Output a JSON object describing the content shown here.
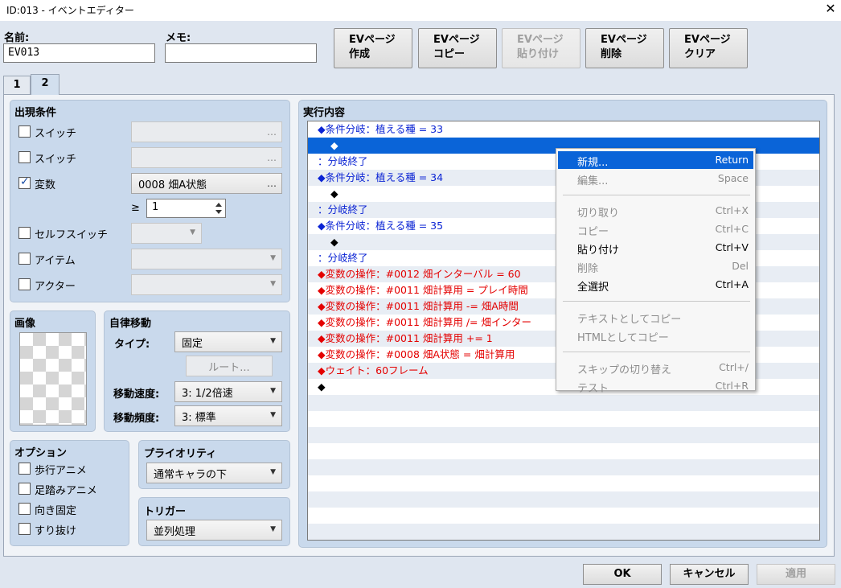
{
  "window": {
    "title": "ID:013 - イベントエディター",
    "close_glyph": "✕"
  },
  "header": {
    "name_label": "名前:",
    "name_value": "EV013",
    "memo_label": "メモ:",
    "memo_value": "",
    "buttons": [
      {
        "line1": "EVページ",
        "line2": "作成",
        "enabled": true
      },
      {
        "line1": "EVページ",
        "line2": "コピー",
        "enabled": true
      },
      {
        "line1": "EVページ",
        "line2": "貼り付け",
        "enabled": false
      },
      {
        "line1": "EVページ",
        "line2": "削除",
        "enabled": true
      },
      {
        "line1": "EVページ",
        "line2": "クリア",
        "enabled": true
      }
    ]
  },
  "tabs": [
    {
      "label": "1",
      "active": false
    },
    {
      "label": "2",
      "active": true
    }
  ],
  "conditions": {
    "title": "出現条件",
    "items": [
      {
        "label": "スイッチ",
        "checked": false,
        "value": "",
        "picker": "…"
      },
      {
        "label": "スイッチ",
        "checked": false,
        "value": "",
        "picker": "…"
      },
      {
        "label": "変数",
        "checked": true,
        "value": "0008 畑A状態",
        "picker": "…"
      },
      {
        "label": "セルフスイッチ",
        "checked": false,
        "value": "",
        "picker": "▼"
      },
      {
        "label": "アイテム",
        "checked": false,
        "value": "",
        "picker": "▼"
      },
      {
        "label": "アクター",
        "checked": false,
        "value": "",
        "picker": "▼"
      }
    ],
    "variable_operator": "≥",
    "variable_value": "1",
    "spin_icon": "up-down-icon"
  },
  "image": {
    "title": "画像"
  },
  "autonomous": {
    "title": "自律移動",
    "type_label": "タイプ:",
    "type_value": "固定",
    "route_button": "ルート...",
    "speed_label": "移動速度:",
    "speed_value": "3: 1/2倍速",
    "freq_label": "移動頻度:",
    "freq_value": "3: 標準"
  },
  "options": {
    "title": "オプション",
    "items": [
      {
        "label": "歩行アニメ",
        "checked": false
      },
      {
        "label": "足踏みアニメ",
        "checked": false
      },
      {
        "label": "向き固定",
        "checked": false
      },
      {
        "label": "すり抜け",
        "checked": false
      }
    ]
  },
  "priority": {
    "title": "プライオリティ",
    "value": "通常キャラの下"
  },
  "trigger": {
    "title": "トリガー",
    "value": "並列処理"
  },
  "contents": {
    "title": "実行内容",
    "rows": [
      {
        "text": "◆条件分岐：植える種 = 33",
        "color": "blue",
        "indent": 12
      },
      {
        "text": "◆",
        "color": "white",
        "indent": 28
      },
      {
        "text": "：分岐終了",
        "color": "blue",
        "indent": 12
      },
      {
        "text": "◆条件分岐：植える種 = 34",
        "color": "blue",
        "indent": 12
      },
      {
        "text": "◆",
        "color": "black",
        "indent": 28
      },
      {
        "text": "：分岐終了",
        "color": "blue",
        "indent": 12
      },
      {
        "text": "◆条件分岐：植える種 = 35",
        "color": "blue",
        "indent": 12
      },
      {
        "text": "◆",
        "color": "black",
        "indent": 28
      },
      {
        "text": "：分岐終了",
        "color": "blue",
        "indent": 12
      },
      {
        "text": "◆変数の操作：#0012 畑インターバル = 60",
        "color": "red",
        "indent": 12
      },
      {
        "text": "◆変数の操作：#0011 畑計算用 = プレイ時間",
        "color": "red",
        "indent": 12
      },
      {
        "text": "◆変数の操作：#0011 畑計算用 -= 畑A時間",
        "color": "red",
        "indent": 12
      },
      {
        "text": "◆変数の操作：#0011 畑計算用 /= 畑インター",
        "color": "red",
        "indent": 12
      },
      {
        "text": "◆変数の操作：#0011 畑計算用 += 1",
        "color": "red",
        "indent": 12
      },
      {
        "text": "◆変数の操作：#0008 畑A状態 = 畑計算用",
        "color": "red",
        "indent": 12
      },
      {
        "text": "◆ウェイト：60フレーム",
        "color": "red",
        "indent": 12
      },
      {
        "text": "◆",
        "color": "black",
        "indent": 12
      },
      {
        "text": "",
        "color": "black",
        "indent": 12
      },
      {
        "text": "",
        "color": "black",
        "indent": 12
      },
      {
        "text": "",
        "color": "black",
        "indent": 12
      },
      {
        "text": "",
        "color": "black",
        "indent": 12
      },
      {
        "text": "",
        "color": "black",
        "indent": 12
      },
      {
        "text": "",
        "color": "black",
        "indent": 12
      },
      {
        "text": "",
        "color": "black",
        "indent": 12
      },
      {
        "text": "",
        "color": "black",
        "indent": 12
      },
      {
        "text": "",
        "color": "black",
        "indent": 12
      }
    ],
    "selected_index": 1
  },
  "context_menu": {
    "groups": [
      [
        {
          "label": "新規...",
          "shortcut": "Return",
          "enabled": true,
          "highlighted": true
        },
        {
          "label": "編集...",
          "shortcut": "Space",
          "enabled": false
        }
      ],
      [
        {
          "label": "切り取り",
          "shortcut": "Ctrl+X",
          "enabled": false
        },
        {
          "label": "コピー",
          "shortcut": "Ctrl+C",
          "enabled": false
        },
        {
          "label": "貼り付け",
          "shortcut": "Ctrl+V",
          "enabled": true
        },
        {
          "label": "削除",
          "shortcut": "Del",
          "enabled": false
        },
        {
          "label": "全選択",
          "shortcut": "Ctrl+A",
          "enabled": true
        }
      ],
      [
        {
          "label": "テキストとしてコピー",
          "shortcut": "",
          "enabled": false
        },
        {
          "label": "HTMLとしてコピー",
          "shortcut": "",
          "enabled": false
        }
      ],
      [
        {
          "label": "スキップの切り替え",
          "shortcut": "Ctrl+/",
          "enabled": false
        },
        {
          "label": "テスト",
          "shortcut": "Ctrl+R",
          "enabled": false
        }
      ]
    ]
  },
  "footer": {
    "ok": "OK",
    "cancel": "キャンセル",
    "apply": "適用",
    "apply_enabled": false
  }
}
